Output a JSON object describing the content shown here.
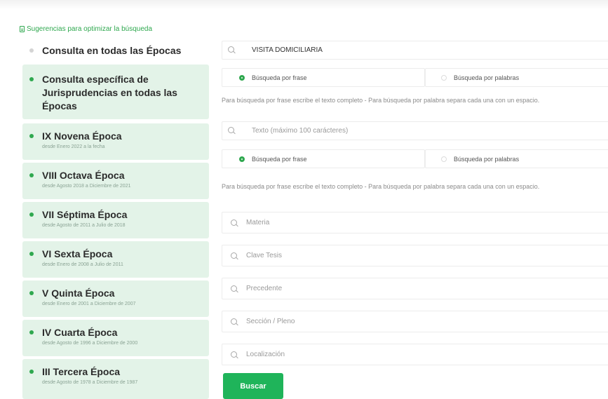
{
  "tips_link": "Sugerencias para optimizar la búsqueda",
  "sidebar": {
    "items": [
      {
        "title": "Consulta en todas las Épocas",
        "subtitle": ""
      },
      {
        "title": "Consulta específica de Jurisprudencias en todas las Épocas",
        "subtitle": ""
      },
      {
        "title": "IX Novena Época",
        "subtitle": "desde Enero 2022 a la fecha"
      },
      {
        "title": "VIII Octava Época",
        "subtitle": "desde Agosto 2018 a Diciembre de 2021"
      },
      {
        "title": "VII Séptima Época",
        "subtitle": "desde Agosto de 2011 a Julio de 2018"
      },
      {
        "title": "VI Sexta Época",
        "subtitle": "desde Enero de 2008 a Julio de 2011"
      },
      {
        "title": "V Quinta Época",
        "subtitle": "desde Enero de 2001 a Diciembre de 2007"
      },
      {
        "title": "IV Cuarta Época",
        "subtitle": "desde Agosto de 1996 a Diciembre de 2000"
      },
      {
        "title": "III Tercera Época",
        "subtitle": "desde Agosto de 1978 a Diciembre de 1987"
      }
    ]
  },
  "form": {
    "search1_value": "VISITA DOMICILIARIA",
    "search2_placeholder": "Texto (máximo 100 carácteres)",
    "radio_phrase": "Búsqueda por frase",
    "radio_words": "Búsqueda por palabras",
    "hint": "Para búsqueda por frase escribe el texto completo - Para búsqueda por palabra separa cada una con un espacio.",
    "materia_placeholder": "Materia",
    "clave_placeholder": "Clave Tesis",
    "precedente_placeholder": "Precedente",
    "seccion_placeholder": "Sección / Pleno",
    "localizacion_placeholder": "Localización",
    "submit_label": "Buscar"
  }
}
